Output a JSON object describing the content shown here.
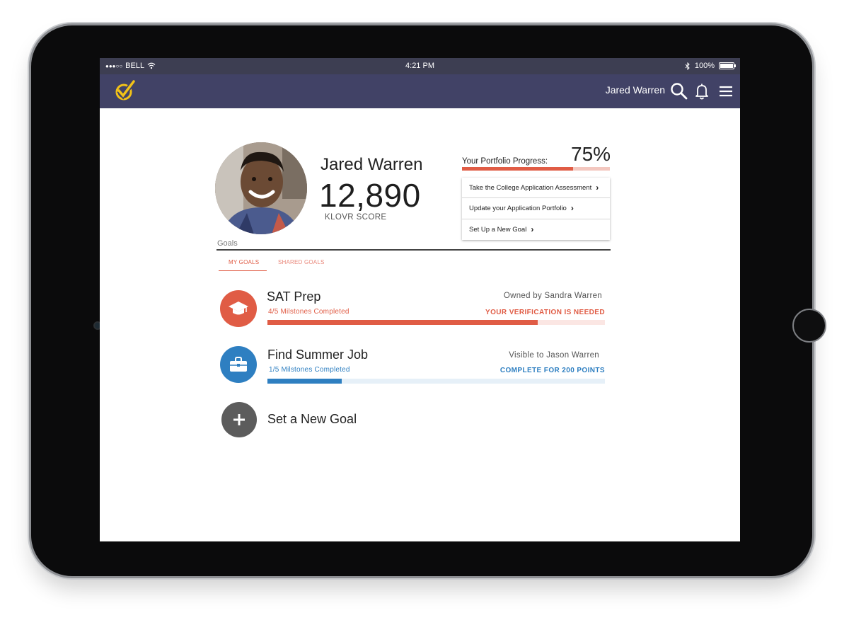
{
  "status_bar": {
    "carrier": "BELL",
    "time": "4:21 PM",
    "battery": "100%"
  },
  "navbar": {
    "user_name": "Jared Warren"
  },
  "profile": {
    "name": "Jared Warren",
    "score": "12,890",
    "score_label": "KLOVR SCORE",
    "goals_label": "Goals"
  },
  "portfolio": {
    "label": "Your Portfolio Progress:",
    "percent_text": "75%",
    "progress": 0.75
  },
  "actions": [
    {
      "label": "Take the College Application Assessment"
    },
    {
      "label": "Update your Application Portfolio"
    },
    {
      "label": "Set Up a New Goal"
    }
  ],
  "tabs": [
    {
      "label": "MY GOALS",
      "active": true
    },
    {
      "label": "SHARED GOALS",
      "active": false
    }
  ],
  "goals": [
    {
      "title": "SAT Prep",
      "milestones": "4/5 Milstones Completed",
      "owner": "Owned by Sandra Warren",
      "status": "YOUR VERIFICATION IS NEEDED",
      "progress": 0.8,
      "color": "#e05c45",
      "track_color": "#fbe6e3",
      "icon": "graduation-cap-icon"
    },
    {
      "title": "Find Summer Job",
      "milestones": "1/5 Milstones Completed",
      "owner": "Visible to Jason Warren",
      "status": "COMPLETE FOR 200 POINTS",
      "progress": 0.22,
      "color": "#2e7fc1",
      "track_color": "#e6f0f8",
      "icon": "briefcase-icon"
    }
  ],
  "new_goal": {
    "label": "Set a New Goal",
    "color": "#5c5c5c",
    "icon": "plus-icon"
  },
  "colors": {
    "navbar": "#414266",
    "accent": "#e05c45",
    "logo": "#f2c218"
  }
}
